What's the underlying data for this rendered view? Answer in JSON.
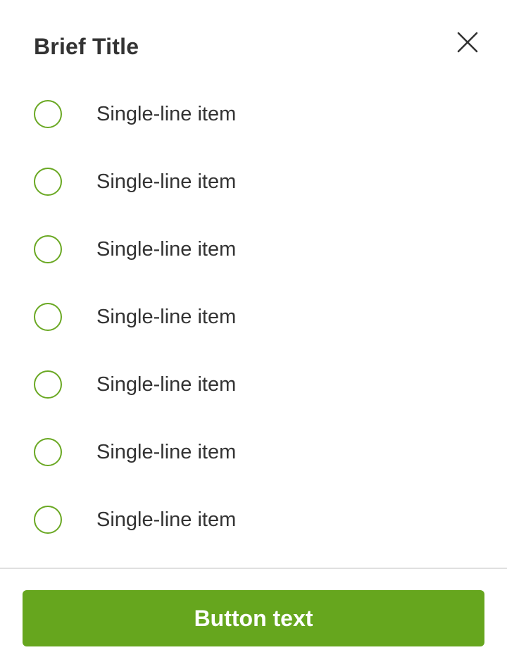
{
  "dialog": {
    "title": "Brief Title",
    "close_icon": "close-icon"
  },
  "options": [
    {
      "label": "Single-line item",
      "selected": false
    },
    {
      "label": "Single-line item",
      "selected": false
    },
    {
      "label": "Single-line item",
      "selected": false
    },
    {
      "label": "Single-line item",
      "selected": false
    },
    {
      "label": "Single-line item",
      "selected": false
    },
    {
      "label": "Single-line item",
      "selected": false
    },
    {
      "label": "Single-line item",
      "selected": false
    }
  ],
  "footer": {
    "button_label": "Button text"
  },
  "colors": {
    "accent": "#66a61e",
    "radio_border": "#6aa823",
    "text": "#333333",
    "divider": "#e0e0e0"
  }
}
